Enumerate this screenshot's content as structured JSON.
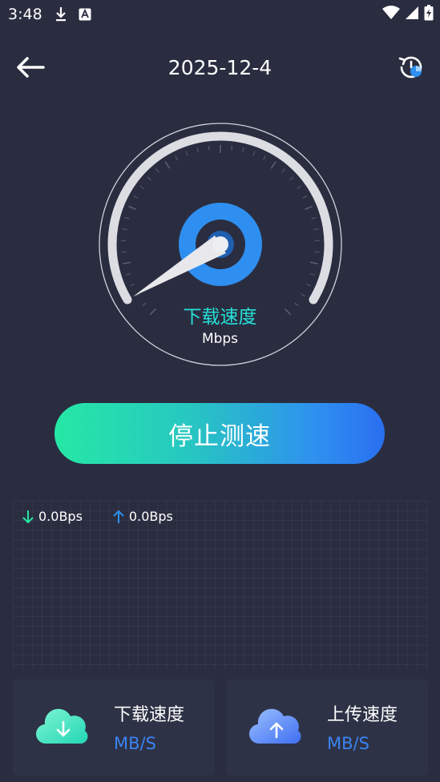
{
  "status_bar": {
    "time": "3:48"
  },
  "header": {
    "title": "2025-12-4"
  },
  "gauge": {
    "label": "下载速度",
    "unit": "Mbps"
  },
  "actions": {
    "stop_label": "停止测速"
  },
  "speeds": {
    "download": "0.0Bps",
    "upload": "0.0Bps"
  },
  "cards": {
    "download": {
      "title": "下载速度",
      "unit": "MB/S"
    },
    "upload": {
      "title": "上传速度",
      "unit": "MB/S"
    }
  },
  "colors": {
    "background": "#2a2d40",
    "card": "#2e3246",
    "accent_cyan": "#25e0d8",
    "accent_blue": "#2e8ff0",
    "accent_green": "#26e8a5"
  }
}
